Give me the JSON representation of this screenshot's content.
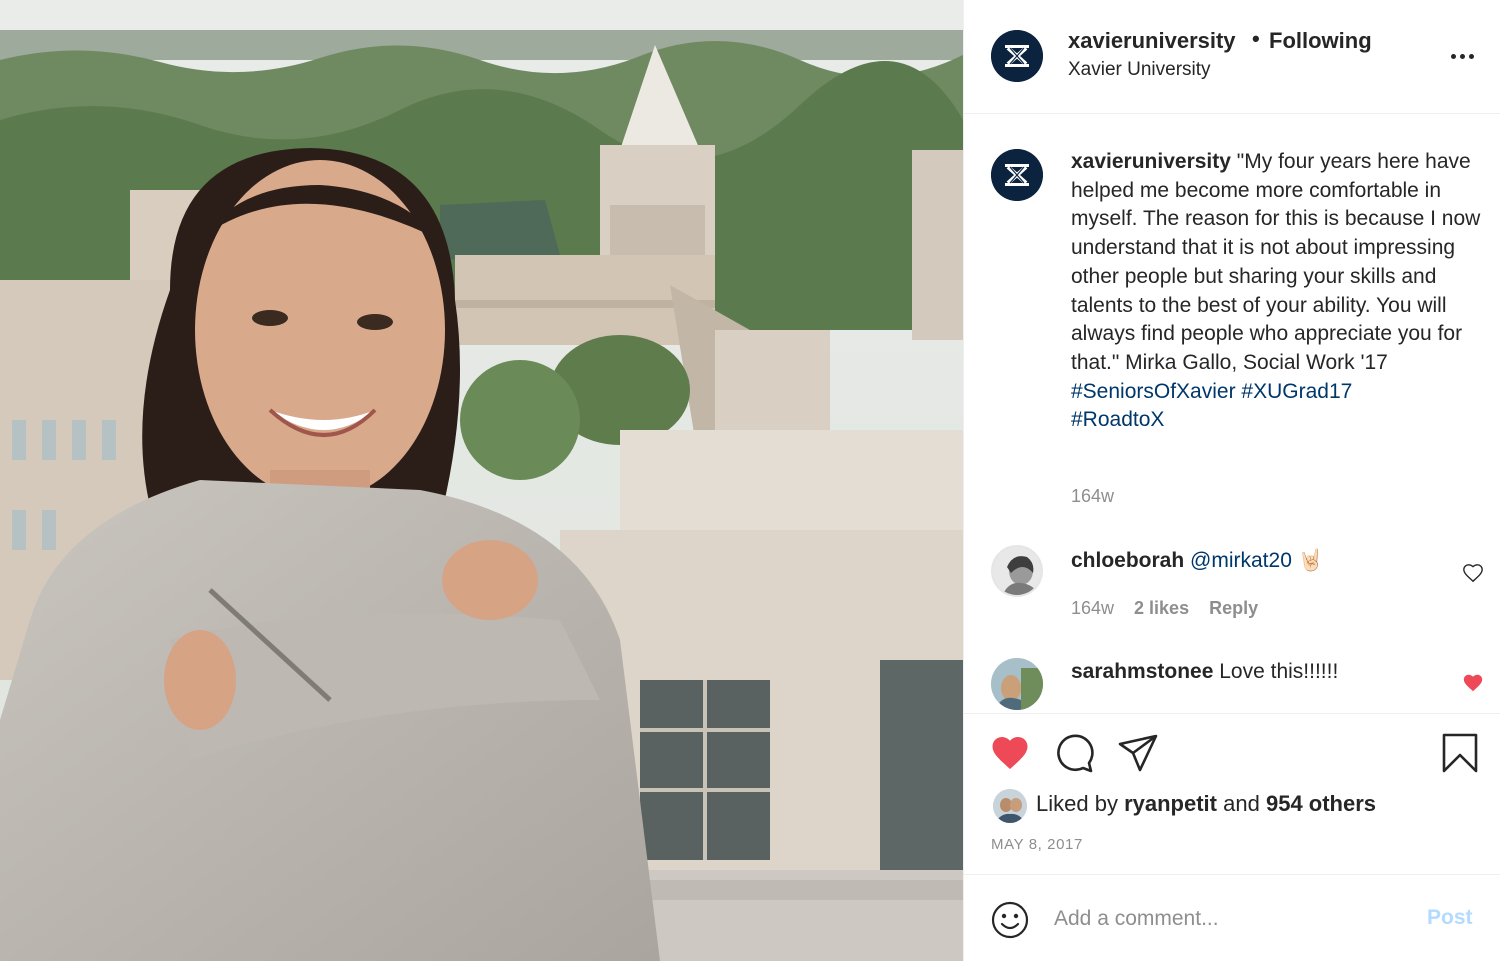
{
  "photo": {
    "subject": "photo"
  },
  "header": {
    "username": "xavieruniversity",
    "separator": "•",
    "follow_status": "Following",
    "location": "Xavier University",
    "avatar_icon": "xavier-x-logo-icon",
    "more_icon": "more-options-icon"
  },
  "caption": {
    "username": "xavieruniversity",
    "text": "\"My four years here have helped me become more comfortable in myself. The reason for this is because I now understand that it is not about impressing other people but sharing your skills and talents to the best of your ability. You will always find people who appreciate you for that.\" Mirka Gallo, Social Work '17",
    "hashtags": [
      "#SeniorsOfXavier",
      "#XUGrad17",
      "#RoadtoX"
    ],
    "time": "164w"
  },
  "comments": [
    {
      "username": "chloeborah",
      "mention": "@mirkat20",
      "emoji": "🤘🏻",
      "time": "164w",
      "likes": "2 likes",
      "reply": "Reply",
      "liked": false
    },
    {
      "username": "sarahmstonee",
      "text": "Love this!!!!!!",
      "liked": true
    }
  ],
  "actions": {
    "like_icon": "heart-filled-icon",
    "comment_icon": "comment-icon",
    "share_icon": "share-icon",
    "save_icon": "bookmark-icon",
    "liked_prefix": "Liked by",
    "liked_user": "ryanpetit",
    "liked_and": "and",
    "liked_others": "954 others",
    "date": "MAY 8, 2017"
  },
  "add_comment": {
    "placeholder": "Add a comment...",
    "post_label": "Post",
    "emoji_icon": "emoji-icon"
  },
  "colors": {
    "like_red": "#ed4956",
    "link_blue": "#00376b",
    "post_disabled": "#b3dbff",
    "brand_navy": "#0c2340",
    "muted": "#8e8e8e"
  }
}
